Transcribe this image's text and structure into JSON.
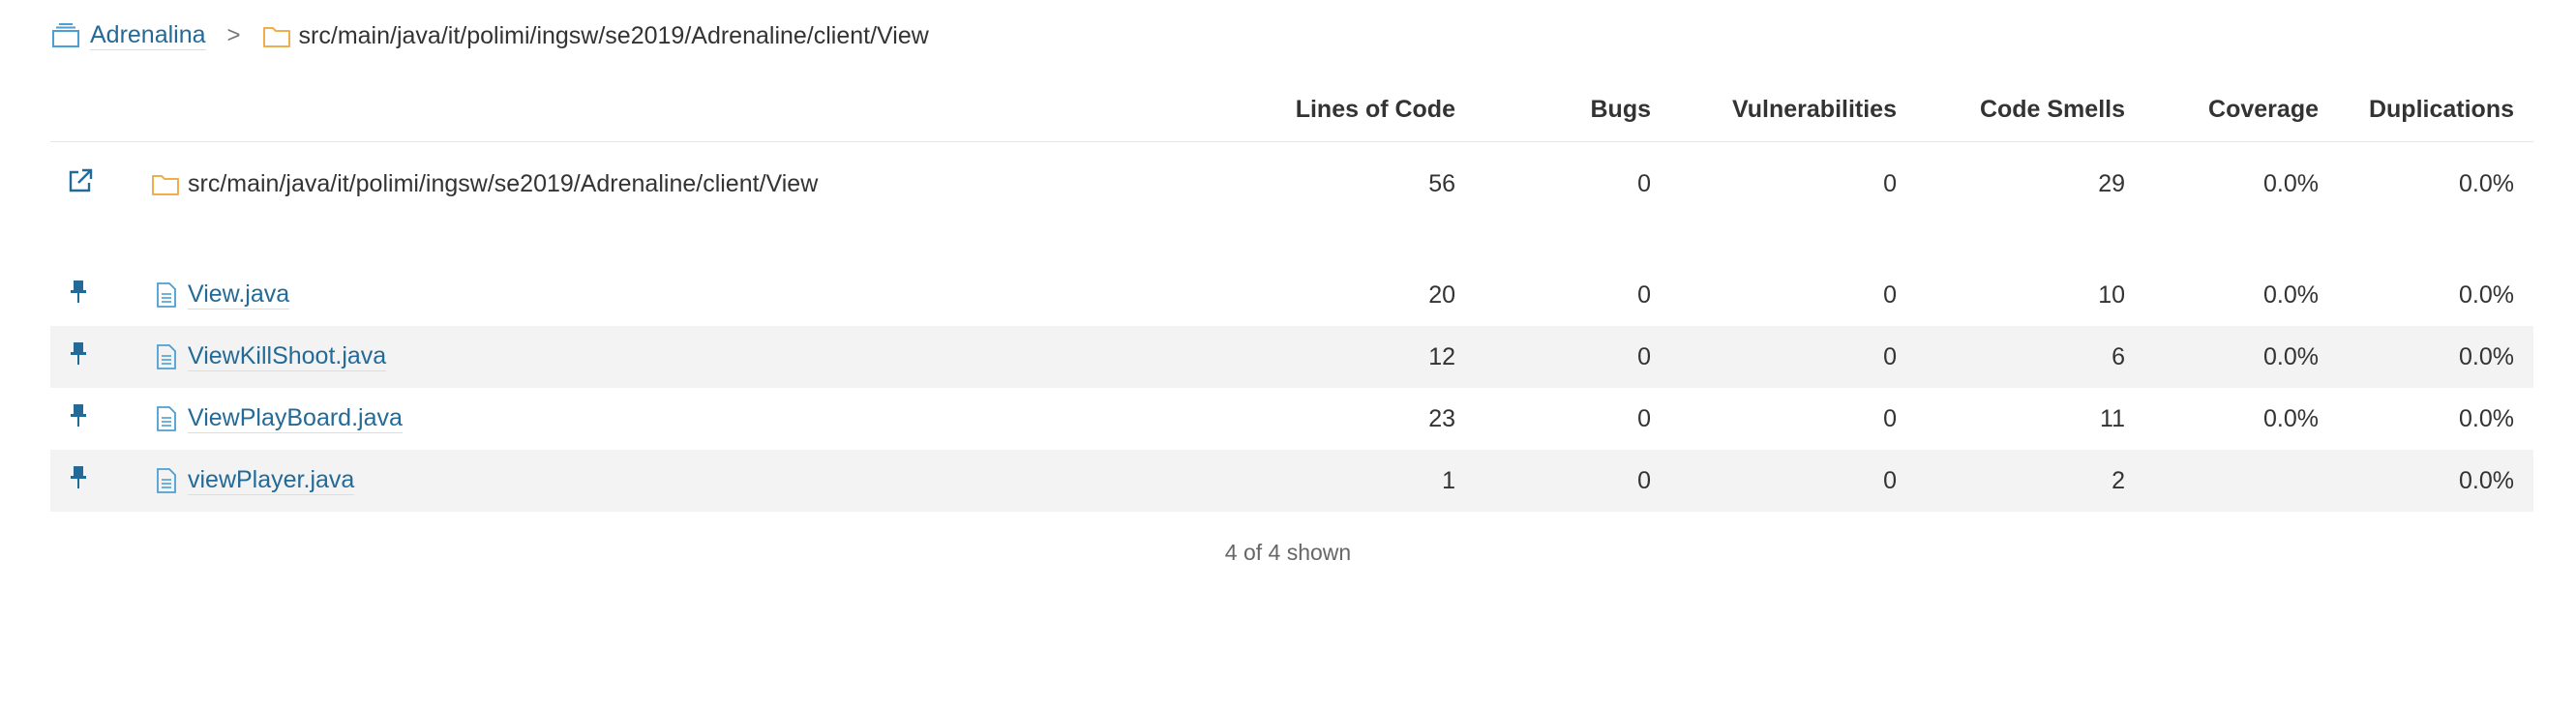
{
  "breadcrumb": {
    "project": "Adrenalina",
    "separator": ">",
    "path": "src/main/java/it/polimi/ingsw/se2019/Adrenaline/client/View"
  },
  "columns": {
    "lines_of_code": "Lines of Code",
    "bugs": "Bugs",
    "vulnerabilities": "Vulnerabilities",
    "code_smells": "Code Smells",
    "coverage": "Coverage",
    "duplications": "Duplications"
  },
  "base": {
    "name": "src/main/java/it/polimi/ingsw/se2019/Adrenaline/client/View",
    "lines_of_code": "56",
    "bugs": "0",
    "vulnerabilities": "0",
    "code_smells": "29",
    "coverage": "0.0%",
    "duplications": "0.0%"
  },
  "files": [
    {
      "name": "View.java",
      "lines_of_code": "20",
      "bugs": "0",
      "vulnerabilities": "0",
      "code_smells": "10",
      "coverage": "0.0%",
      "duplications": "0.0%"
    },
    {
      "name": "ViewKillShoot.java",
      "lines_of_code": "12",
      "bugs": "0",
      "vulnerabilities": "0",
      "code_smells": "6",
      "coverage": "0.0%",
      "duplications": "0.0%"
    },
    {
      "name": "ViewPlayBoard.java",
      "lines_of_code": "23",
      "bugs": "0",
      "vulnerabilities": "0",
      "code_smells": "11",
      "coverage": "0.0%",
      "duplications": "0.0%"
    },
    {
      "name": "viewPlayer.java",
      "lines_of_code": "1",
      "bugs": "0",
      "vulnerabilities": "0",
      "code_smells": "2",
      "coverage": "",
      "duplications": "0.0%"
    }
  ],
  "footer": {
    "count_text": "4 of 4 shown"
  },
  "icons": {
    "project": "project-icon",
    "folder": "folder-icon",
    "open_component": "external-link-icon",
    "pin": "pin-icon",
    "file": "file-icon"
  },
  "colors": {
    "link": "#236a97",
    "folder": "#f0ad4e",
    "pin": "#236a97",
    "row_alt": "#f3f3f3"
  }
}
